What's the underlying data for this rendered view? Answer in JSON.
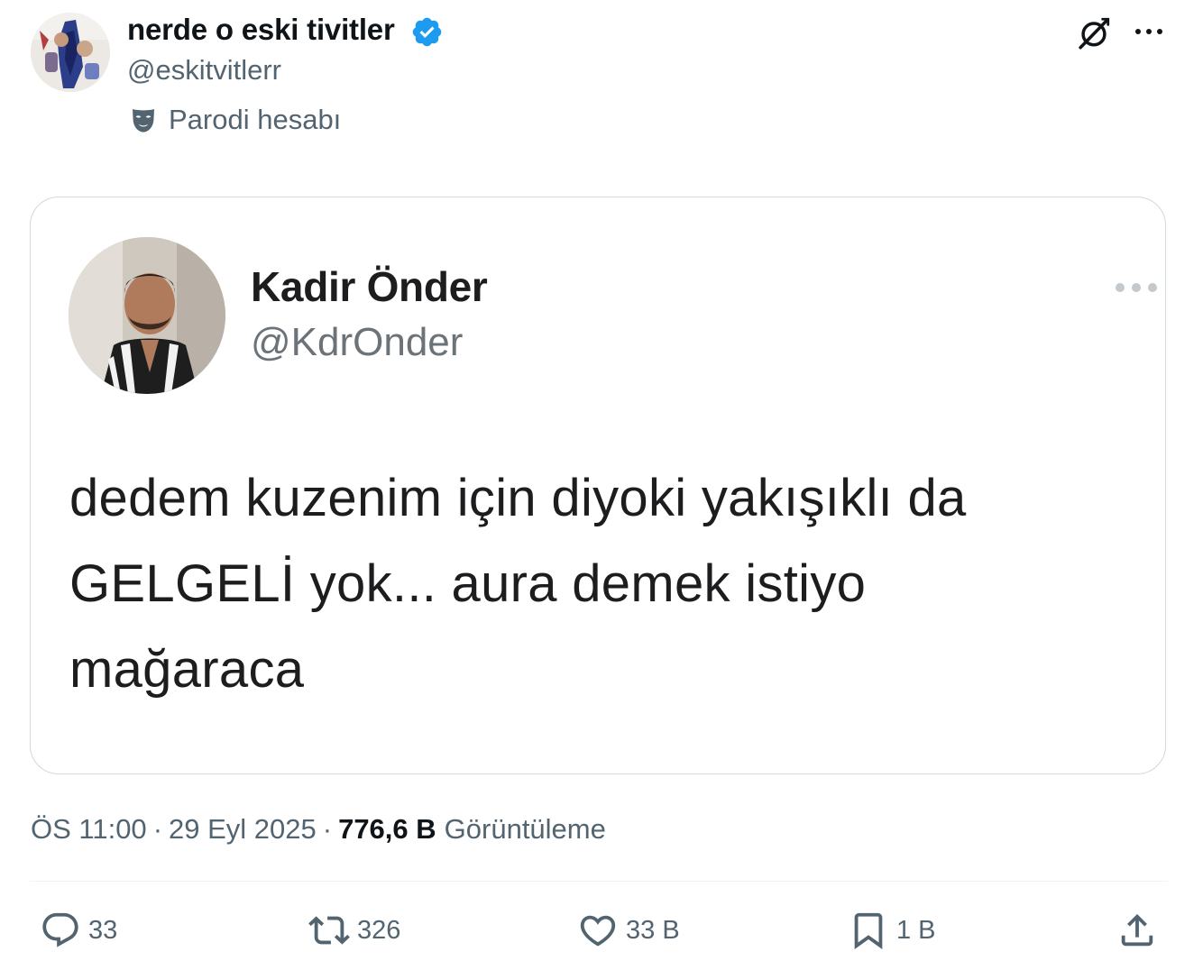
{
  "tweet": {
    "author": {
      "display_name": "nerde o eski tivitler",
      "handle": "@eskitvitlerr",
      "label": "Parodi hesabı",
      "avatar_icon": "avatar-photo",
      "verified_icon": "verified-badge-icon"
    },
    "header_actions": {
      "grok_icon": "grok-icon",
      "more_icon": "more-options-icon"
    },
    "embedded_screenshot": {
      "name": "Kadir Önder",
      "handle": "@KdrOnder",
      "text_lines": [
        "dedem kuzenim için diyoki yakışıklı da",
        "GELGELİ yok... aura demek istiyo",
        "mağaraca"
      ]
    },
    "meta": {
      "time": "ÖS 11:00",
      "date": "29 Eyl 2025",
      "separator": "·",
      "views_count": "776,6 B",
      "views_label": "Görüntüleme"
    },
    "actions": {
      "replies": "33",
      "retweets": "326",
      "likes": "33 B",
      "bookmarks": "1 B"
    }
  },
  "colors": {
    "text_primary": "#0f1419",
    "text_secondary": "#536471",
    "verified_blue": "#1d9bf0",
    "border": "#cfd9de"
  }
}
